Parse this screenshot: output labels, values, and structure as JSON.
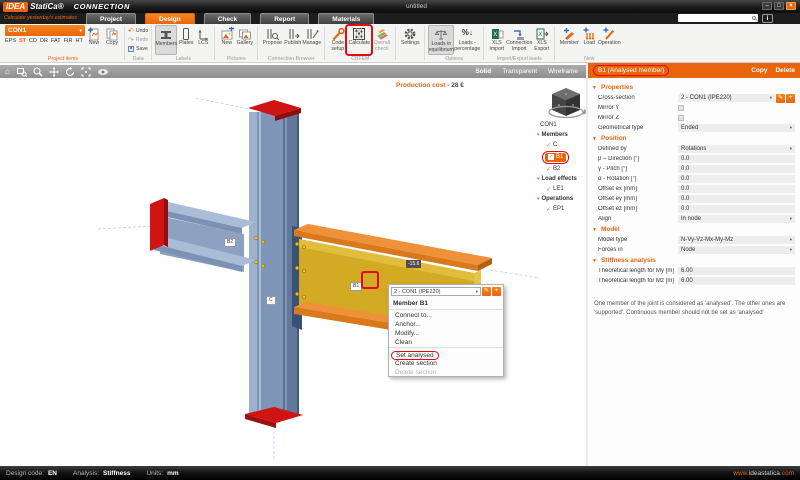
{
  "window": {
    "title": "untitled",
    "brand": "IDEA",
    "brand_suffix": "StatiCa®",
    "product": "CONNECTION",
    "tagline": "Calculate yesterday's estimates"
  },
  "tabs": [
    {
      "label": "Project"
    },
    {
      "label": "Design"
    },
    {
      "label": "Check"
    },
    {
      "label": "Report"
    },
    {
      "label": "Materials"
    }
  ],
  "ribbon": {
    "project_items": {
      "combo": "CON1",
      "codes": [
        "EPS",
        "ST",
        "CD",
        "DR",
        "FAT",
        "FIR",
        "HT"
      ],
      "active_code": "ST",
      "new": "New",
      "copy": "Copy",
      "caption": "Project items"
    },
    "data": {
      "caption": "Data",
      "undo": "Undo",
      "redo": "Redo",
      "save": "Save"
    },
    "labels": {
      "caption": "Labels",
      "members": "Members",
      "plates": "Plates",
      "lcs": "LCS"
    },
    "pictures": {
      "caption": "Pictures",
      "new": "New",
      "gallery": "Gallery"
    },
    "browser": {
      "caption": "Connection Browser",
      "propose": "Propose",
      "publish": "Publish",
      "manage": "Manage"
    },
    "cbfem": {
      "caption": "CBFEM",
      "code_setup": "Code setup",
      "calculate": "Calculate",
      "overall_check": "Overall check"
    },
    "settings": {
      "label": "Settings"
    },
    "options": {
      "caption": "Options",
      "loads_eq": "Loads in equilibrium",
      "loads_pct": "Loads - percentage"
    },
    "import_export": {
      "caption": "Import/Export loads",
      "xls_import": "XLS Import",
      "conn_import": "Connection Import",
      "xls_export": "XLS Export"
    },
    "new": {
      "caption": "New",
      "member": "Member",
      "load": "Load",
      "operation": "Operation"
    }
  },
  "viewport": {
    "modes": [
      "Solid",
      "Transparent",
      "Wireframe"
    ],
    "active_mode": "Solid",
    "production_cost_label": "Production cost",
    "production_cost_value": "- 28 €",
    "labels": {
      "b1": "B1",
      "b2": "B2",
      "c": "C",
      "dim": "-15.6"
    }
  },
  "tree": {
    "project": "CON1",
    "members_header": "Members",
    "items_members": [
      "C",
      "B1",
      "B2"
    ],
    "load_header": "Load effects",
    "items_load": [
      "LE1"
    ],
    "ops_header": "Operations",
    "items_ops": [
      "EP1"
    ]
  },
  "context_menu": {
    "combo": "2 - CON1 (IPE220)",
    "title": "Member B1",
    "item_connect": "Connect to...",
    "item_anchor": "Anchor...",
    "item_modify": "Modify...",
    "item_clean": "Clean",
    "item_set_analysed": "Set analysed",
    "item_create_section": "Create section",
    "item_delete_section": "Delete section"
  },
  "panel": {
    "header": "B1 (Analysed member)",
    "copy": "Copy",
    "delete": "Delete",
    "properties": {
      "title": "Properties",
      "cross_section_label": "Cross-section",
      "cross_section_value": "2 - CON1 (IPE220)",
      "mirror_y": "Mirror Y",
      "mirror_z": "Mirror Z",
      "geom_type_label": "Geometrical type",
      "geom_type_value": "Ended"
    },
    "position": {
      "title": "Position",
      "defined_by_label": "Defined by",
      "defined_by_value": "Rotations",
      "beta_label": "β – Direction [°]",
      "beta": "0.0",
      "gamma_label": "γ - Pitch [°]",
      "gamma": "0.0",
      "alpha_label": "α - Rotation [°]",
      "alpha": "0.0",
      "ex_label": "Offset ex [mm]",
      "ex": "0.0",
      "ey_label": "Offset ey [mm]",
      "ey": "0.0",
      "ez_label": "Offset ez [mm]",
      "ez": "0.0",
      "align_label": "Align",
      "align_value": "In node"
    },
    "model": {
      "title": "Model",
      "type_label": "Model type",
      "type_value": "N-Vy-Vz-Mx-My-Mz",
      "forces_label": "Forces in",
      "forces_value": "Node"
    },
    "stiffness": {
      "title": "Stiffness analysis",
      "my_label": "Theoretical length for My [m]",
      "my": "6.00",
      "mz_label": "Theoretical length for Mz [m]",
      "mz": "6.00"
    },
    "note": "One member of the joint is considered as 'analysed'. The other ones are 'supported'. Continuous member should not be set as 'analysed'"
  },
  "statusbar": {
    "code_label": "Design code:",
    "code": "EN",
    "analysis_label": "Analysis:",
    "analysis": "Stiffness",
    "units_label": "Units:",
    "units": "mm",
    "website_www": "www.",
    "website_mid": "ideastatica",
    "website_tld": ".com"
  },
  "icons": {
    "check": "✓",
    "caret": "▾",
    "section_caret": "▼",
    "undo": "↶",
    "redo": "↷",
    "minimize": "–",
    "maximize": "□",
    "close": "×",
    "info": "i",
    "home": "⌂",
    "pencil": "✎",
    "plus": "+",
    "percent": "%↓"
  },
  "colors": {
    "accent": "#e8650d",
    "annotation": "#e30b13",
    "steel_blue": "#7e95b8",
    "beam_flange_orange": "#d9791c",
    "beam_web_yellow": "#d2aa23",
    "cap_red": "#d01414"
  }
}
